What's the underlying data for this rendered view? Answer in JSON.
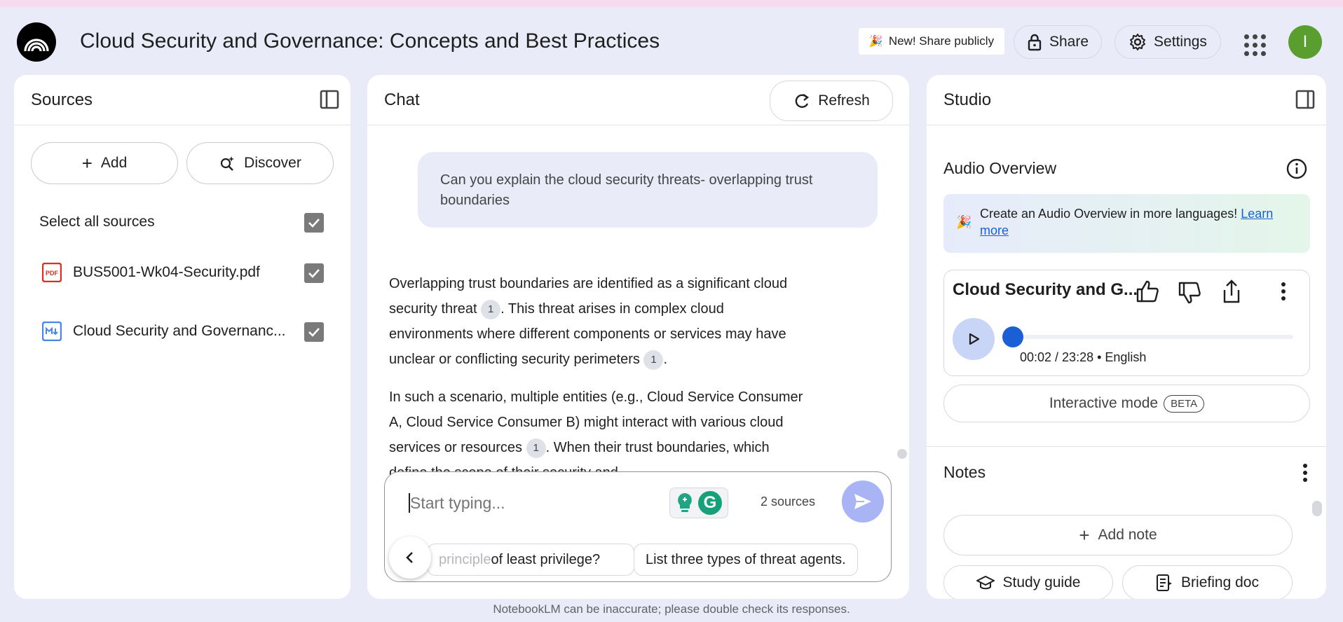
{
  "header": {
    "title": "Cloud Security and Governance: Concepts and Best Practices",
    "new_share_label": "New! Share publicly",
    "share_label": "Share",
    "settings_label": "Settings",
    "avatar_letter": "I"
  },
  "sources": {
    "title": "Sources",
    "add_label": "Add",
    "discover_label": "Discover",
    "select_all_label": "Select all sources",
    "items": [
      {
        "name": "BUS5001-Wk04-Security.pdf",
        "type": "pdf"
      },
      {
        "name": "Cloud Security and Governanc...",
        "type": "markdown"
      }
    ]
  },
  "chat": {
    "title": "Chat",
    "refresh_label": "Refresh",
    "user_question": "Can you explain the cloud security threats- overlapping trust boundaries",
    "response": {
      "p1_a": "Overlapping trust boundaries are identified as a significant cloud security threat ",
      "p1_b": ". This threat arises in complex cloud environments where different components or services may have unclear or conflicting security perimeters ",
      "p1_c": ".",
      "p2_a": "In such a scenario, multiple entities (e.g., Cloud Service Consumer A, Cloud Service Consumer B) might interact with various cloud services or resources ",
      "p2_b": ". When their trust boundaries, which define the scope of their security and",
      "citation": "1"
    },
    "input_placeholder": "Start typing...",
    "sources_count": "2 sources",
    "suggestions": [
      "principle of least privilege?",
      "List three types of threat agents."
    ],
    "suggestion_partial_prefix": "principle",
    "suggestion_partial_rest": " of least privilege?",
    "disclaimer": "NotebookLM can be inaccurate; please double check its responses."
  },
  "studio": {
    "title": "Studio",
    "audio_overview_title": "Audio Overview",
    "banner_text": "Create an Audio Overview in more languages! ",
    "banner_link": "Learn more",
    "player_title": "Cloud Security and G...",
    "time_readout": "00:02 / 23:28 • English",
    "progress": 0.001,
    "interactive_label": "Interactive mode",
    "beta_badge": "BETA",
    "notes_title": "Notes",
    "add_note_label": "Add note",
    "study_guide_label": "Study guide",
    "briefing_doc_label": "Briefing doc"
  },
  "colors": {
    "accent_blue": "#1a5fd6",
    "background": "#e9ecf8",
    "avatar_green": "#5a9e2f",
    "send_button": "#a8b4f4"
  }
}
